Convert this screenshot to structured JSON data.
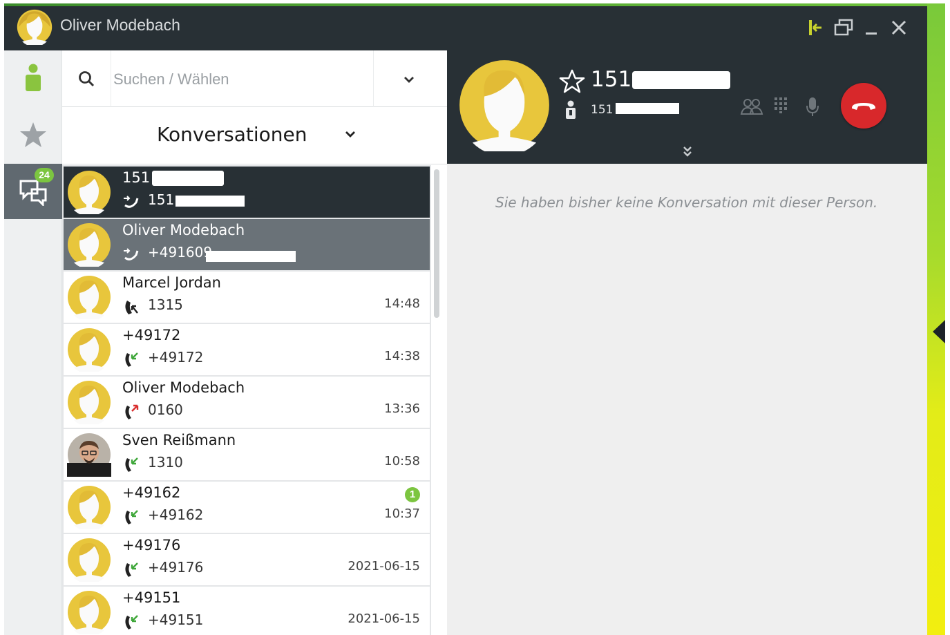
{
  "window": {
    "title": "Oliver Modebach",
    "accent_color": "#7cc540"
  },
  "nav": {
    "conversations_badge": "24"
  },
  "search": {
    "placeholder": "Suchen / Wählen"
  },
  "conversations": {
    "header": "Konversationen",
    "items": [
      {
        "name": "151",
        "number": "151",
        "time": "",
        "direction": "outgoing-active",
        "state": "selected",
        "avatar": "placeholder"
      },
      {
        "name": "Oliver Modebach",
        "number": "+491609",
        "time": "",
        "direction": "outgoing-active",
        "state": "hover",
        "avatar": "placeholder"
      },
      {
        "name": "Marcel Jordan",
        "number": "1315",
        "time": "14:48",
        "direction": "outgoing",
        "state": "normal",
        "avatar": "placeholder"
      },
      {
        "name": "+49172",
        "number": "+49172",
        "time": "14:38",
        "direction": "incoming-answered",
        "state": "normal",
        "avatar": "placeholder"
      },
      {
        "name": "Oliver Modebach",
        "number": "0160",
        "time": "13:36",
        "direction": "missed",
        "state": "normal",
        "avatar": "placeholder"
      },
      {
        "name": "Sven Reißmann",
        "number": "1310",
        "time": "10:58",
        "direction": "incoming-answered",
        "state": "normal",
        "avatar": "photo"
      },
      {
        "name": "+49162",
        "number": "+49162",
        "time": "10:37",
        "unread": "1",
        "direction": "incoming-answered",
        "state": "normal",
        "avatar": "placeholder"
      },
      {
        "name": "+49176",
        "number": "+49176",
        "time": "2021-06-15",
        "direction": "incoming-answered",
        "state": "normal",
        "avatar": "placeholder"
      },
      {
        "name": "+49151",
        "number": "+49151",
        "time": "2021-06-15",
        "direction": "incoming-answered",
        "state": "normal",
        "avatar": "placeholder"
      }
    ]
  },
  "call": {
    "callee_name": "151",
    "callee_number": "151",
    "hangup_color": "#d8282b"
  },
  "detail": {
    "empty_message": "Sie haben bisher keine Konversation mit dieser Person."
  }
}
